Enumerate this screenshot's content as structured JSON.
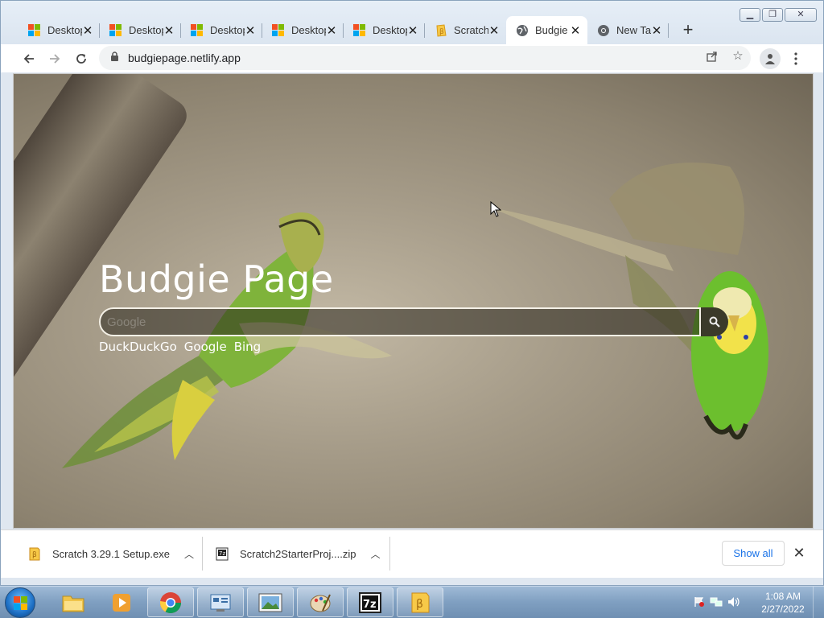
{
  "browser": {
    "tabs": [
      {
        "title": "Desktop",
        "icon": "microsoft-icon"
      },
      {
        "title": "Desktop",
        "icon": "microsoft-icon"
      },
      {
        "title": "Desktop",
        "icon": "microsoft-icon"
      },
      {
        "title": "Desktop",
        "icon": "microsoft-icon"
      },
      {
        "title": "Desktop",
        "icon": "microsoft-icon"
      },
      {
        "title": "Scratch",
        "icon": "scratch-icon"
      },
      {
        "title": "Budgie",
        "icon": "globe-icon",
        "active": true
      },
      {
        "title": "New Tab",
        "icon": "chrome-icon"
      }
    ],
    "new_tab_glyph": "+",
    "close_glyph": "✕",
    "address": "budgiepage.netlify.app"
  },
  "page": {
    "title": "Budgie Page",
    "search_placeholder": "Google",
    "engines": [
      "DuckDuckGo",
      "Google",
      "Bing"
    ]
  },
  "downloads": {
    "items": [
      {
        "name": "Scratch 3.29.1 Setup.exe",
        "icon": "scratch-file-icon"
      },
      {
        "name": "Scratch2StarterProj....zip",
        "icon": "zip-file-icon"
      }
    ],
    "show_all": "Show all"
  },
  "taskbar": {
    "time": "1:08 AM",
    "date": "2/27/2022"
  },
  "colors": {
    "accent": "#1a73e8",
    "ms_red": "#f25022",
    "ms_green": "#7fba00",
    "ms_blue": "#00a4ef",
    "ms_yellow": "#ffb900"
  }
}
